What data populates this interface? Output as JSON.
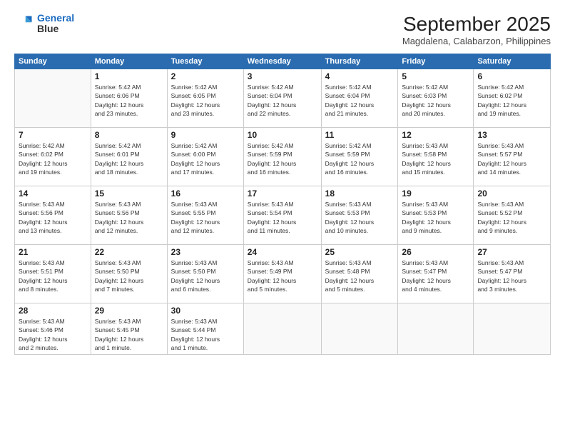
{
  "header": {
    "logo_line1": "General",
    "logo_line2": "Blue",
    "month": "September 2025",
    "location": "Magdalena, Calabarzon, Philippines"
  },
  "weekdays": [
    "Sunday",
    "Monday",
    "Tuesday",
    "Wednesday",
    "Thursday",
    "Friday",
    "Saturday"
  ],
  "weeks": [
    [
      {
        "day": "",
        "info": ""
      },
      {
        "day": "1",
        "info": "Sunrise: 5:42 AM\nSunset: 6:06 PM\nDaylight: 12 hours\nand 23 minutes."
      },
      {
        "day": "2",
        "info": "Sunrise: 5:42 AM\nSunset: 6:05 PM\nDaylight: 12 hours\nand 23 minutes."
      },
      {
        "day": "3",
        "info": "Sunrise: 5:42 AM\nSunset: 6:04 PM\nDaylight: 12 hours\nand 22 minutes."
      },
      {
        "day": "4",
        "info": "Sunrise: 5:42 AM\nSunset: 6:04 PM\nDaylight: 12 hours\nand 21 minutes."
      },
      {
        "day": "5",
        "info": "Sunrise: 5:42 AM\nSunset: 6:03 PM\nDaylight: 12 hours\nand 20 minutes."
      },
      {
        "day": "6",
        "info": "Sunrise: 5:42 AM\nSunset: 6:02 PM\nDaylight: 12 hours\nand 19 minutes."
      }
    ],
    [
      {
        "day": "7",
        "info": "Sunrise: 5:42 AM\nSunset: 6:02 PM\nDaylight: 12 hours\nand 19 minutes."
      },
      {
        "day": "8",
        "info": "Sunrise: 5:42 AM\nSunset: 6:01 PM\nDaylight: 12 hours\nand 18 minutes."
      },
      {
        "day": "9",
        "info": "Sunrise: 5:42 AM\nSunset: 6:00 PM\nDaylight: 12 hours\nand 17 minutes."
      },
      {
        "day": "10",
        "info": "Sunrise: 5:42 AM\nSunset: 5:59 PM\nDaylight: 12 hours\nand 16 minutes."
      },
      {
        "day": "11",
        "info": "Sunrise: 5:42 AM\nSunset: 5:59 PM\nDaylight: 12 hours\nand 16 minutes."
      },
      {
        "day": "12",
        "info": "Sunrise: 5:43 AM\nSunset: 5:58 PM\nDaylight: 12 hours\nand 15 minutes."
      },
      {
        "day": "13",
        "info": "Sunrise: 5:43 AM\nSunset: 5:57 PM\nDaylight: 12 hours\nand 14 minutes."
      }
    ],
    [
      {
        "day": "14",
        "info": "Sunrise: 5:43 AM\nSunset: 5:56 PM\nDaylight: 12 hours\nand 13 minutes."
      },
      {
        "day": "15",
        "info": "Sunrise: 5:43 AM\nSunset: 5:56 PM\nDaylight: 12 hours\nand 12 minutes."
      },
      {
        "day": "16",
        "info": "Sunrise: 5:43 AM\nSunset: 5:55 PM\nDaylight: 12 hours\nand 12 minutes."
      },
      {
        "day": "17",
        "info": "Sunrise: 5:43 AM\nSunset: 5:54 PM\nDaylight: 12 hours\nand 11 minutes."
      },
      {
        "day": "18",
        "info": "Sunrise: 5:43 AM\nSunset: 5:53 PM\nDaylight: 12 hours\nand 10 minutes."
      },
      {
        "day": "19",
        "info": "Sunrise: 5:43 AM\nSunset: 5:53 PM\nDaylight: 12 hours\nand 9 minutes."
      },
      {
        "day": "20",
        "info": "Sunrise: 5:43 AM\nSunset: 5:52 PM\nDaylight: 12 hours\nand 9 minutes."
      }
    ],
    [
      {
        "day": "21",
        "info": "Sunrise: 5:43 AM\nSunset: 5:51 PM\nDaylight: 12 hours\nand 8 minutes."
      },
      {
        "day": "22",
        "info": "Sunrise: 5:43 AM\nSunset: 5:50 PM\nDaylight: 12 hours\nand 7 minutes."
      },
      {
        "day": "23",
        "info": "Sunrise: 5:43 AM\nSunset: 5:50 PM\nDaylight: 12 hours\nand 6 minutes."
      },
      {
        "day": "24",
        "info": "Sunrise: 5:43 AM\nSunset: 5:49 PM\nDaylight: 12 hours\nand 5 minutes."
      },
      {
        "day": "25",
        "info": "Sunrise: 5:43 AM\nSunset: 5:48 PM\nDaylight: 12 hours\nand 5 minutes."
      },
      {
        "day": "26",
        "info": "Sunrise: 5:43 AM\nSunset: 5:47 PM\nDaylight: 12 hours\nand 4 minutes."
      },
      {
        "day": "27",
        "info": "Sunrise: 5:43 AM\nSunset: 5:47 PM\nDaylight: 12 hours\nand 3 minutes."
      }
    ],
    [
      {
        "day": "28",
        "info": "Sunrise: 5:43 AM\nSunset: 5:46 PM\nDaylight: 12 hours\nand 2 minutes."
      },
      {
        "day": "29",
        "info": "Sunrise: 5:43 AM\nSunset: 5:45 PM\nDaylight: 12 hours\nand 1 minute."
      },
      {
        "day": "30",
        "info": "Sunrise: 5:43 AM\nSunset: 5:44 PM\nDaylight: 12 hours\nand 1 minute."
      },
      {
        "day": "",
        "info": ""
      },
      {
        "day": "",
        "info": ""
      },
      {
        "day": "",
        "info": ""
      },
      {
        "day": "",
        "info": ""
      }
    ]
  ]
}
